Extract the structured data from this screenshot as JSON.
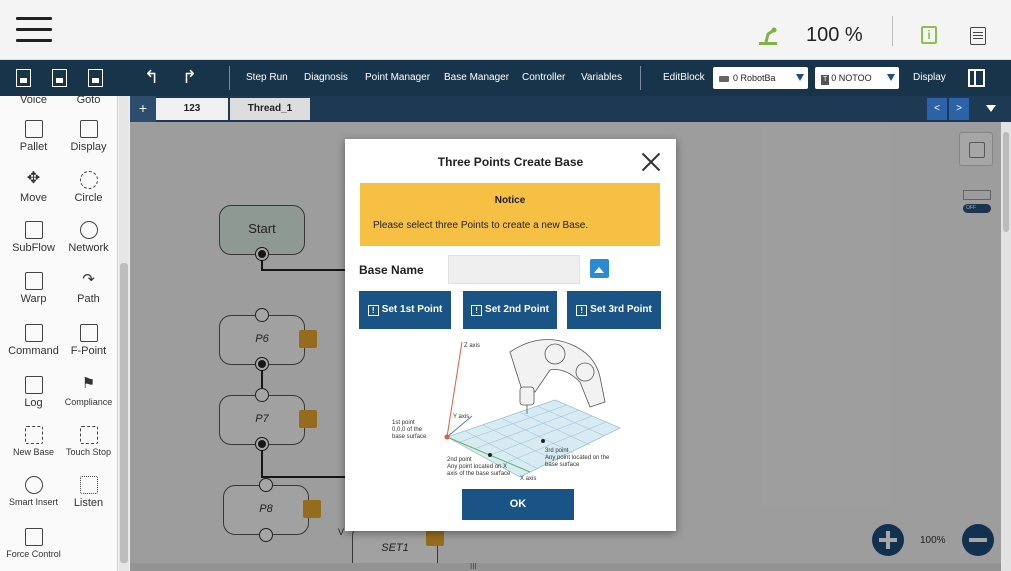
{
  "status": {
    "speed": "100 %"
  },
  "toolbar": {
    "items": [
      "Step Run",
      "Diagnosis",
      "Point Manager",
      "Base Manager",
      "Controller",
      "Variables"
    ],
    "editblock": "EditBlock",
    "robot_base": "0 RobotBa",
    "tool_badge": "T",
    "tool": "0 NOTOO",
    "display": "Display"
  },
  "palette": {
    "items": [
      {
        "label": "Voice"
      },
      {
        "label": "Goto"
      },
      {
        "label": "Pallet"
      },
      {
        "label": "Display"
      },
      {
        "label": "Move"
      },
      {
        "label": "Circle"
      },
      {
        "label": "SubFlow"
      },
      {
        "label": "Network"
      },
      {
        "label": "Warp"
      },
      {
        "label": "Path"
      },
      {
        "label": "Command"
      },
      {
        "label": "F-Point"
      },
      {
        "label": "Log"
      },
      {
        "label": "Compliance"
      },
      {
        "label": "New Base"
      },
      {
        "label": "Touch Stop"
      },
      {
        "label": "Smart Insert"
      },
      {
        "label": "Listen"
      },
      {
        "label": "Force Control"
      }
    ]
  },
  "tabs": {
    "add": "+",
    "items": [
      {
        "label": "123"
      },
      {
        "label": "Thread_1"
      }
    ],
    "prev": "<",
    "next": ">"
  },
  "flow": {
    "start": "Start",
    "nodes": [
      "P6",
      "P7",
      "P8"
    ],
    "set_node": "SET1",
    "side_toggle": "OFF",
    "zoom": "100%",
    "v_label": "V",
    "hscroll_mark": "III"
  },
  "dialog": {
    "title": "Three Points Create Base",
    "notice_title": "Notice",
    "notice_text": "Please select three Points to create a new Base.",
    "base_name_label": "Base Name",
    "base_name_value": "",
    "buttons": [
      "Set 1st Point",
      "Set 2nd Point",
      "Set 3rd Point"
    ],
    "ok": "OK",
    "diagram": {
      "z_axis": "Z axis",
      "y_axis": "Y axis",
      "x_axis": "X axis",
      "p1_line1": "1st point",
      "p1_line2": "0,0,0 of the",
      "p1_line3": "base surface",
      "p2_line1": "2nd point",
      "p2_line2": "Any point located on X",
      "p2_line3": "axis of the base surface",
      "p3_line1": "3rd point",
      "p3_line2": "Any point located on the",
      "p3_line3": "base surface"
    }
  },
  "colors": {
    "toolbar": "#18344a",
    "accent": "#1a5487",
    "notice": "#f5c044",
    "tag": "#e4a72a"
  }
}
